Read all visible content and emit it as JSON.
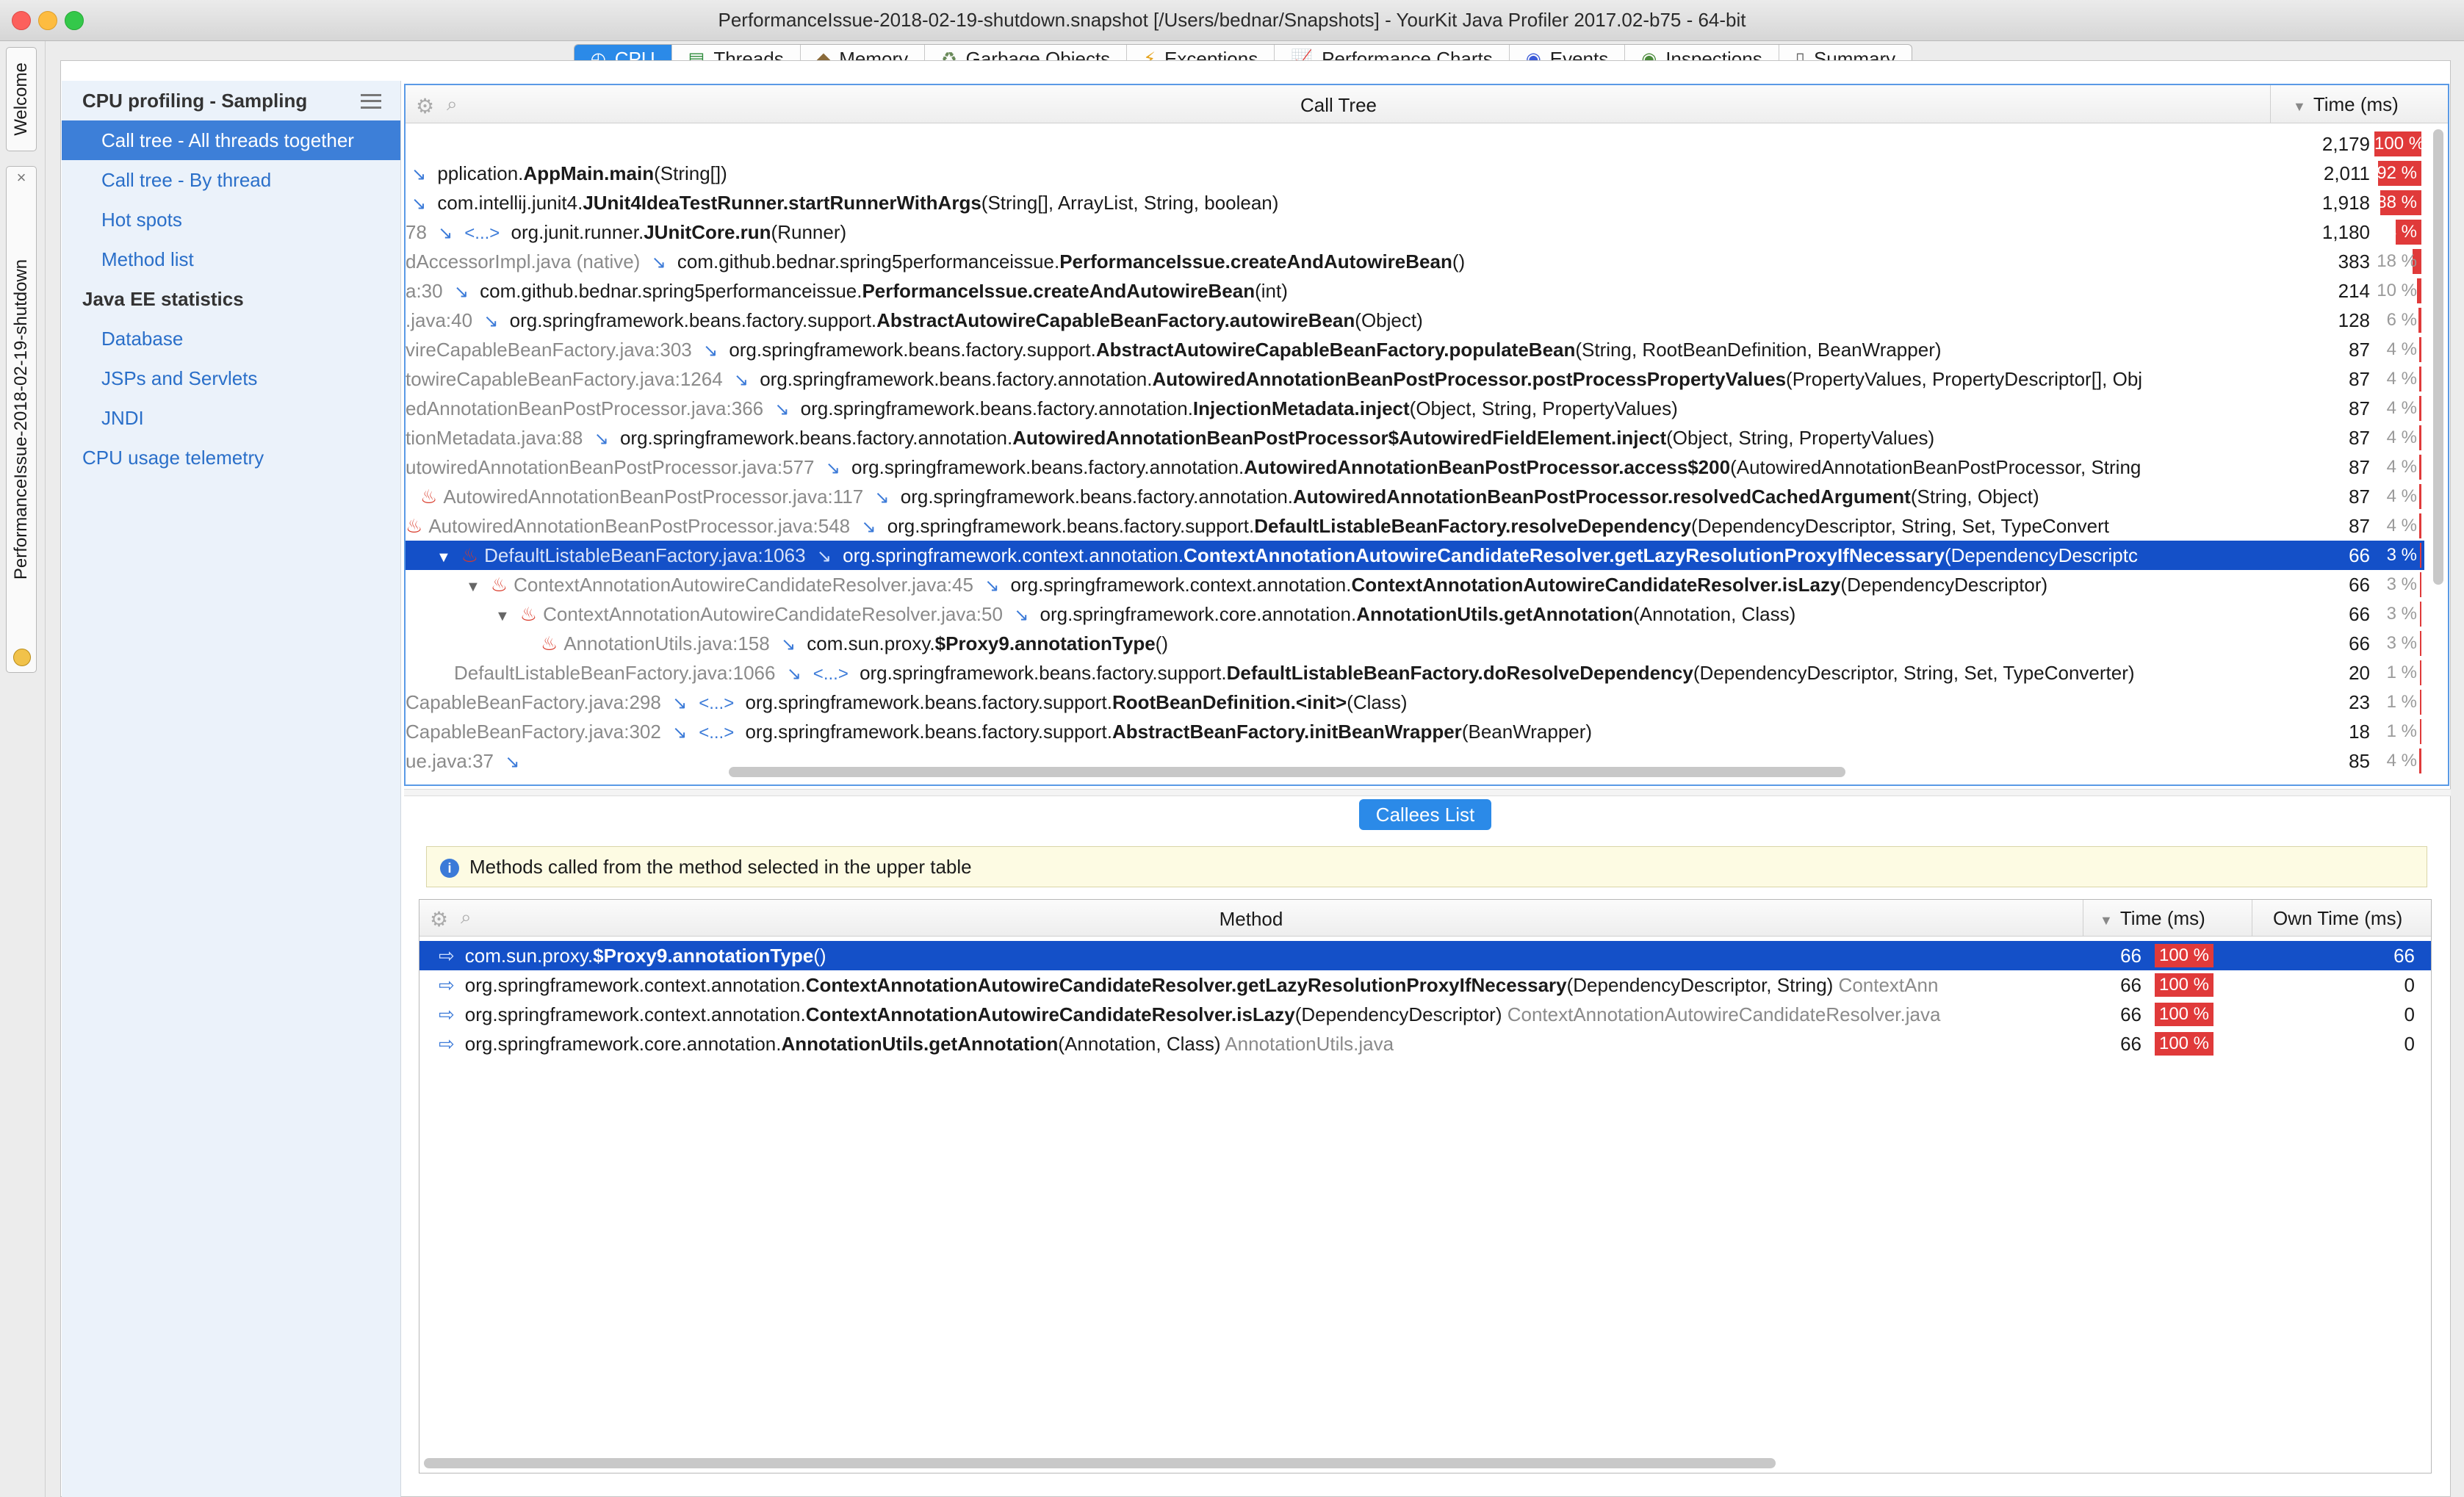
{
  "window": {
    "title": "PerformanceIssue-2018-02-19-shutdown.snapshot [/Users/bednar/Snapshots] - YourKit Java Profiler 2017.02-b75 - 64-bit"
  },
  "tabs": [
    {
      "label": "CPU",
      "icon": "cpu-icon",
      "active": true
    },
    {
      "label": "Threads",
      "icon": "threads-icon"
    },
    {
      "label": "Memory",
      "icon": "memory-icon"
    },
    {
      "label": "Garbage Objects",
      "icon": "trash-icon"
    },
    {
      "label": "Exceptions",
      "icon": "lightning-icon"
    },
    {
      "label": "Performance Charts",
      "icon": "chart-icon"
    },
    {
      "label": "Events",
      "icon": "eye-icon"
    },
    {
      "label": "Inspections",
      "icon": "eye-icon"
    },
    {
      "label": "Summary",
      "icon": "document-icon"
    }
  ],
  "side_tabs": {
    "welcome": "Welcome",
    "snapshot": "PerformanceIssue-2018-02-19-shutdown",
    "close": "×"
  },
  "sidebar": {
    "group1": "CPU profiling - Sampling",
    "items1": [
      "Call tree - All threads together",
      "Call tree - By thread",
      "Hot spots",
      "Method list"
    ],
    "group2": "Java EE statistics",
    "items2": [
      "Database",
      "JSPs and Servlets",
      "JNDI"
    ],
    "telemetry": "CPU usage telemetry"
  },
  "call_tree": {
    "title": "Call Tree",
    "time_header": "Time (ms)",
    "rows": [
      {
        "pre": "",
        "pkg": "",
        "method": "",
        "args": "",
        "time": "2,179",
        "pct": "100 %",
        "pctv": 100
      },
      {
        "pre": "",
        "pkg": "pplication.",
        "method": "AppMain.main",
        "args": "(String[])",
        "time": "2,011",
        "pct": "92 %",
        "pctv": 92
      },
      {
        "pre": "",
        "pkg": "com.intellij.junit4.",
        "method": "JUnit4IdeaTestRunner.startRunnerWithArgs",
        "args": "(String[], ArrayList, String, boolean)",
        "time": "1,918",
        "pct": "88 %",
        "pctv": 88
      },
      {
        "pre": "78",
        "mid": "<...>",
        "pkg": "org.junit.runner.",
        "method": "JUnitCore.run",
        "args": "(Runner)",
        "time": "1,180",
        "pct": "54 %",
        "pctv": 54
      },
      {
        "pre": "dAccessorImpl.java (native)",
        "pkg": "com.github.bednar.spring5performanceissue.",
        "method": "PerformanceIssue.createAndAutowireBean",
        "args": "()",
        "time": "383",
        "pct": "18 %",
        "pctv": 18
      },
      {
        "pre": "a:30",
        "pkg": "com.github.bednar.spring5performanceissue.",
        "method": "PerformanceIssue.createAndAutowireBean",
        "args": "(int)",
        "time": "214",
        "pct": "10 %",
        "pctv": 10
      },
      {
        "pre": ".java:40",
        "pkg": "org.springframework.beans.factory.support.",
        "method": "AbstractAutowireCapableBeanFactory.autowireBean",
        "args": "(Object)",
        "time": "128",
        "pct": "6 %",
        "pctv": 6
      },
      {
        "pre": "vireCapableBeanFactory.java:303",
        "pkg": "org.springframework.beans.factory.support.",
        "method": "AbstractAutowireCapableBeanFactory.populateBean",
        "args": "(String, RootBeanDefinition, BeanWrapper)",
        "time": "87",
        "pct": "4 %",
        "pctv": 4
      },
      {
        "pre": "towireCapableBeanFactory.java:1264",
        "pkg": "org.springframework.beans.factory.annotation.",
        "method": "AutowiredAnnotationBeanPostProcessor.postProcessPropertyValues",
        "args": "(PropertyValues, PropertyDescriptor[], Obj",
        "time": "87",
        "pct": "4 %",
        "pctv": 4
      },
      {
        "pre": "edAnnotationBeanPostProcessor.java:366",
        "pkg": "org.springframework.beans.factory.annotation.",
        "method": "InjectionMetadata.inject",
        "args": "(Object, String, PropertyValues)",
        "time": "87",
        "pct": "4 %",
        "pctv": 4
      },
      {
        "pre": "tionMetadata.java:88",
        "pkg": "org.springframework.beans.factory.annotation.",
        "method": "AutowiredAnnotationBeanPostProcessor$AutowiredFieldElement.inject",
        "args": "(Object, String, PropertyValues)",
        "time": "87",
        "pct": "4 %",
        "pctv": 4
      },
      {
        "pre": "utowiredAnnotationBeanPostProcessor.java:577",
        "pkg": "org.springframework.beans.factory.annotation.",
        "method": "AutowiredAnnotationBeanPostProcessor.access$200",
        "args": "(AutowiredAnnotationBeanPostProcessor, String",
        "time": "87",
        "pct": "4 %",
        "pctv": 4
      },
      {
        "pre": "AutowiredAnnotationBeanPostProcessor.java:117",
        "pkg": "org.springframework.beans.factory.annotation.",
        "method": "AutowiredAnnotationBeanPostProcessor.resolvedCachedArgument",
        "args": "(String, Object)",
        "time": "87",
        "pct": "4 %",
        "pctv": 4
      },
      {
        "pre": "AutowiredAnnotationBeanPostProcessor.java:548",
        "pkg": "org.springframework.beans.factory.support.",
        "method": "DefaultListableBeanFactory.resolveDependency",
        "args": "(DependencyDescriptor, String, Set, TypeConvert",
        "time": "87",
        "pct": "4 %",
        "pctv": 4
      },
      {
        "pre": "DefaultListableBeanFactory.java:1063",
        "pkg": "org.springframework.context.annotation.",
        "method": "ContextAnnotationAutowireCandidateResolver.getLazyResolutionProxyIfNecessary",
        "args": "(DependencyDescriptc",
        "time": "66",
        "pct": "3 %",
        "pctv": 3
      },
      {
        "pre": "ContextAnnotationAutowireCandidateResolver.java:45",
        "pkg": "org.springframework.context.annotation.",
        "method": "ContextAnnotationAutowireCandidateResolver.isLazy",
        "args": "(DependencyDescriptor)",
        "time": "66",
        "pct": "3 %",
        "pctv": 3
      },
      {
        "pre": "ContextAnnotationAutowireCandidateResolver.java:50",
        "pkg": "org.springframework.core.annotation.",
        "method": "AnnotationUtils.getAnnotation",
        "args": "(Annotation, Class)",
        "time": "66",
        "pct": "3 %",
        "pctv": 3
      },
      {
        "pre": "AnnotationUtils.java:158",
        "pkg": "com.sun.proxy.",
        "method": "$Proxy9.annotationType",
        "args": "()",
        "time": "66",
        "pct": "3 %",
        "pctv": 3
      },
      {
        "pre": "DefaultListableBeanFactory.java:1066",
        "mid": "<...>",
        "pkg": "org.springframework.beans.factory.support.",
        "method": "DefaultListableBeanFactory.doResolveDependency",
        "args": "(DependencyDescriptor, String, Set, TypeConverter)",
        "time": "20",
        "pct": "1 %",
        "pctv": 1
      },
      {
        "pre": "CapableBeanFactory.java:298",
        "mid": "<...>",
        "pkg": "org.springframework.beans.factory.support.",
        "method": "RootBeanDefinition.<init>",
        "args": "(Class)",
        "time": "23",
        "pct": "1 %",
        "pctv": 1
      },
      {
        "pre": "CapableBeanFactory.java:302",
        "mid": "<...>",
        "pkg": "org.springframework.beans.factory.support.",
        "method": "AbstractBeanFactory.initBeanWrapper",
        "args": "(BeanWrapper)",
        "time": "18",
        "pct": "1 %",
        "pctv": 1
      },
      {
        "pre": "ue.java:37",
        "pkg": "",
        "method": "",
        "args": "",
        "time": "85",
        "pct": "4 %",
        "pctv": 4
      }
    ]
  },
  "callees": {
    "button": "Callees List",
    "info": "Methods called from the method selected in the upper table",
    "method_header": "Method",
    "time_header": "Time (ms)",
    "own_header": "Own Time (ms)",
    "rows": [
      {
        "pkg": "com.sun.proxy.",
        "method": "$Proxy9.annotationType",
        "args": "()",
        "file": "",
        "time": "66",
        "pct": "100 %",
        "own": "66"
      },
      {
        "pkg": "org.springframework.context.annotation.",
        "method": "ContextAnnotationAutowireCandidateResolver.getLazyResolutionProxyIfNecessary",
        "args": "(DependencyDescriptor, String)",
        "file": "ContextAnn",
        "time": "66",
        "pct": "100 %",
        "own": "0"
      },
      {
        "pkg": "org.springframework.context.annotation.",
        "method": "ContextAnnotationAutowireCandidateResolver.isLazy",
        "args": "(DependencyDescriptor)",
        "file": "ContextAnnotationAutowireCandidateResolver.java",
        "time": "66",
        "pct": "100 %",
        "own": "0"
      },
      {
        "pkg": "org.springframework.core.annotation.",
        "method": "AnnotationUtils.getAnnotation",
        "args": "(Annotation, Class)",
        "file": "AnnotationUtils.java",
        "time": "66",
        "pct": "100 %",
        "own": "0"
      }
    ]
  }
}
